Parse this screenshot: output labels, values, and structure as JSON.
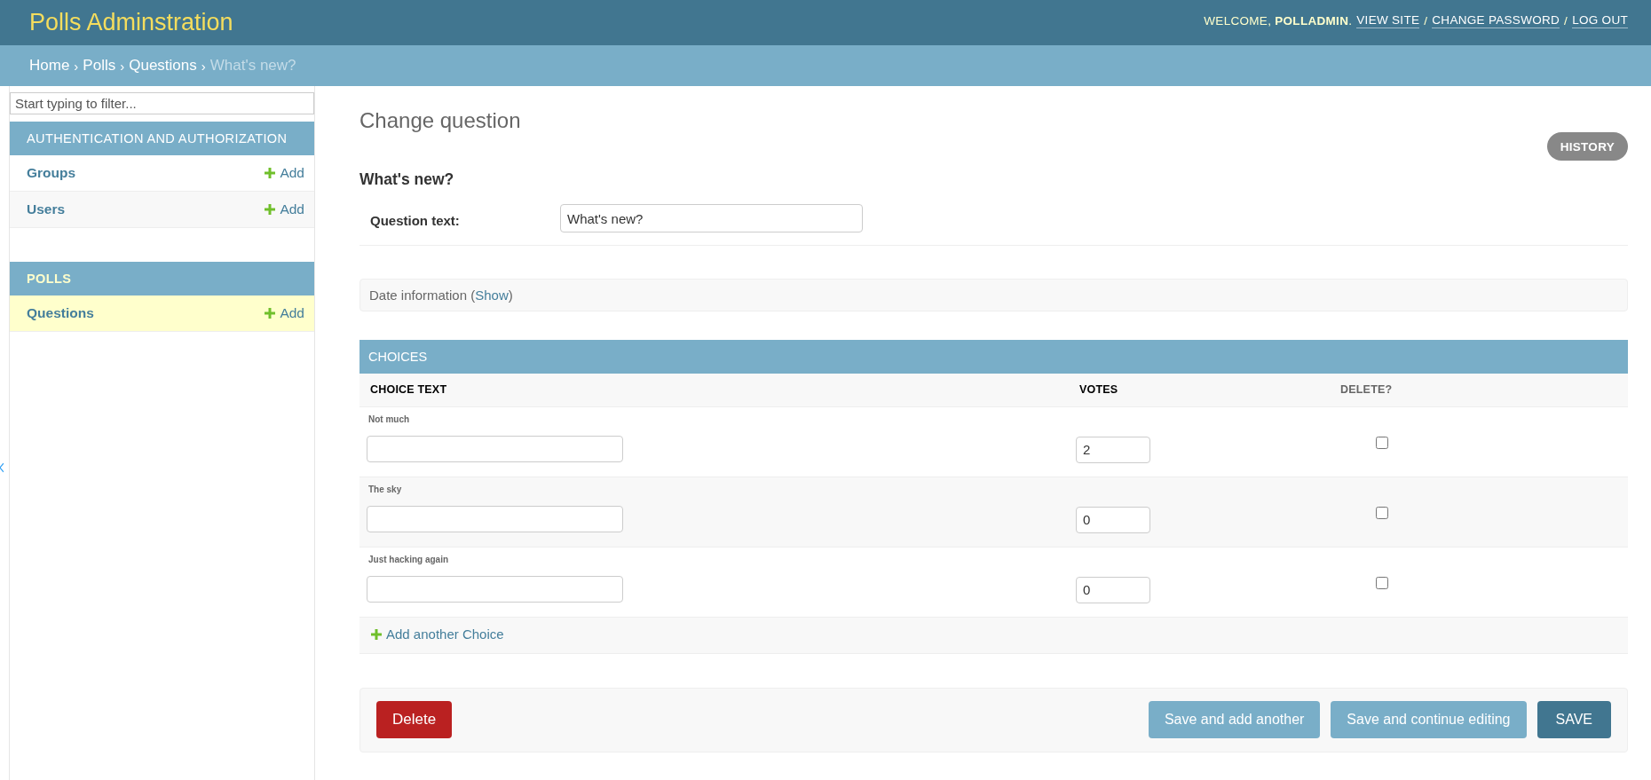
{
  "header": {
    "title": "Polls Adminstration",
    "user_tools": [
      {
        "kind": "text",
        "label": "WELCOME, **POLLADMIN**."
      },
      {
        "kind": "link",
        "label": "VIEW SITE"
      },
      {
        "kind": "separator",
        "label": "/"
      },
      {
        "kind": "link",
        "label": "CHANGE PASSWORD"
      },
      {
        "kind": "separator",
        "label": "/"
      },
      {
        "kind": "link",
        "label": "LOG OUT"
      }
    ]
  },
  "breadcrumbs": [
    {
      "kind": "link",
      "label": "Home"
    },
    {
      "kind": "separator",
      "label": "›"
    },
    {
      "kind": "link",
      "label": "Polls"
    },
    {
      "kind": "separator",
      "label": "›"
    },
    {
      "kind": "link",
      "label": "Questions"
    },
    {
      "kind": "separator",
      "label": "›"
    },
    {
      "kind": "current",
      "label": "What's new?"
    }
  ],
  "sidebar": {
    "filter": {
      "placeholder": "Start typing to filter..."
    },
    "modules": [
      {
        "title": "AUTHENTICATION AND AUTHORIZATION",
        "selected": false,
        "models": [
          {
            "name": "Groups",
            "add": "Add",
            "selected": false
          },
          {
            "name": "Users",
            "add": "Add",
            "selected": false
          }
        ]
      },
      {
        "title": "POLLS",
        "selected": true,
        "models": [
          {
            "name": "Questions",
            "add": "Add",
            "selected": true
          }
        ]
      }
    ]
  },
  "content": {
    "title": "Change question",
    "history": "HISTORY",
    "object_title": "What's new?",
    "fields": [
      {
        "label": "Question text:",
        "value": "What's new?"
      }
    ],
    "collapsed_fieldset": {
      "heading": "Date information",
      "open_paren": "(",
      "toggle": "Show",
      "close_paren": ")"
    },
    "inline": {
      "title": "CHOICES",
      "columns": [
        "CHOICE TEXT",
        "VOTES",
        "DELETE?"
      ],
      "rows": [
        {
          "label": "Not much",
          "votes": "2",
          "delete": false
        },
        {
          "label": "The sky",
          "votes": "0",
          "delete": false
        },
        {
          "label": "Just hacking again",
          "votes": "0",
          "delete": false
        }
      ],
      "add_row": "Add another Choice"
    },
    "submit_row": {
      "delete": "Delete",
      "buttons": [
        {
          "kind": "secondary",
          "label": "Save and add another"
        },
        {
          "kind": "secondary",
          "label": "Save and continue editing"
        },
        {
          "kind": "primary",
          "label": "SAVE"
        }
      ]
    }
  }
}
